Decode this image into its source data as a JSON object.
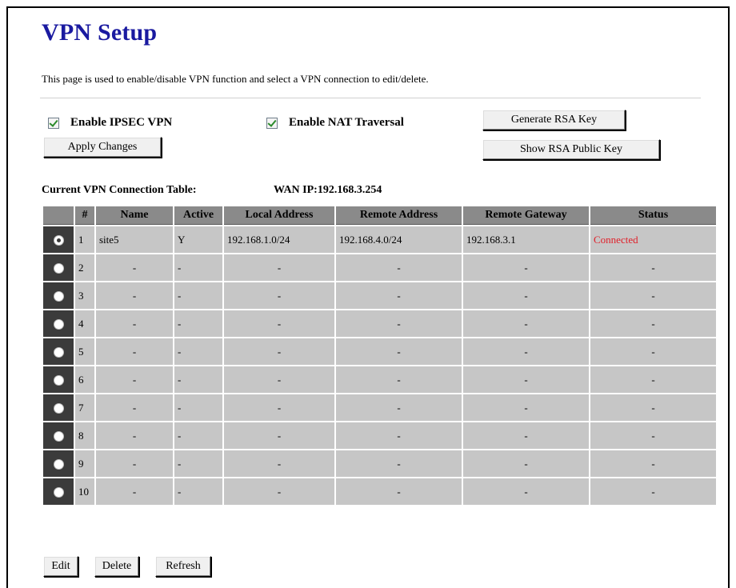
{
  "page": {
    "title": "VPN Setup",
    "description": "This page is used to enable/disable VPN function and select a VPN connection to edit/delete."
  },
  "options": {
    "enable_ipsec_label": "Enable IPSEC VPN",
    "enable_ipsec_checked": true,
    "enable_nat_label": "Enable NAT Traversal",
    "enable_nat_checked": true
  },
  "buttons": {
    "apply": "Apply Changes",
    "generate_rsa": "Generate RSA Key",
    "show_rsa": "Show RSA Public Key",
    "edit": "Edit",
    "delete": "Delete",
    "refresh": "Refresh"
  },
  "table": {
    "label": "Current VPN Connection Table:",
    "wan_ip": "WAN IP:192.168.3.254",
    "columns": [
      "",
      "#",
      "Name",
      "Active",
      "Local Address",
      "Remote Address",
      "Remote Gateway",
      "Status"
    ],
    "rows": [
      {
        "num": "1",
        "name": "site5",
        "active": "Y",
        "local": "192.168.1.0/24",
        "remote": "192.168.4.0/24",
        "gateway": "192.168.3.1",
        "status": "Connected",
        "selected": true
      },
      {
        "num": "2",
        "name": "-",
        "active": "-",
        "local": "-",
        "remote": "-",
        "gateway": "-",
        "status": "-",
        "selected": false
      },
      {
        "num": "3",
        "name": "-",
        "active": "-",
        "local": "-",
        "remote": "-",
        "gateway": "-",
        "status": "-",
        "selected": false
      },
      {
        "num": "4",
        "name": "-",
        "active": "-",
        "local": "-",
        "remote": "-",
        "gateway": "-",
        "status": "-",
        "selected": false
      },
      {
        "num": "5",
        "name": "-",
        "active": "-",
        "local": "-",
        "remote": "-",
        "gateway": "-",
        "status": "-",
        "selected": false
      },
      {
        "num": "6",
        "name": "-",
        "active": "-",
        "local": "-",
        "remote": "-",
        "gateway": "-",
        "status": "-",
        "selected": false
      },
      {
        "num": "7",
        "name": "-",
        "active": "-",
        "local": "-",
        "remote": "-",
        "gateway": "-",
        "status": "-",
        "selected": false
      },
      {
        "num": "8",
        "name": "-",
        "active": "-",
        "local": "-",
        "remote": "-",
        "gateway": "-",
        "status": "-",
        "selected": false
      },
      {
        "num": "9",
        "name": "-",
        "active": "-",
        "local": "-",
        "remote": "-",
        "gateway": "-",
        "status": "-",
        "selected": false
      },
      {
        "num": "10",
        "name": "-",
        "active": "-",
        "local": "-",
        "remote": "-",
        "gateway": "-",
        "status": "-",
        "selected": false
      }
    ]
  },
  "colors": {
    "title": "#1a1aa0",
    "header_bg": "#8a8a8a",
    "row_bg": "#c6c6c6",
    "radio_cell_bg": "#3b3b3b",
    "connected": "#e0202a"
  }
}
